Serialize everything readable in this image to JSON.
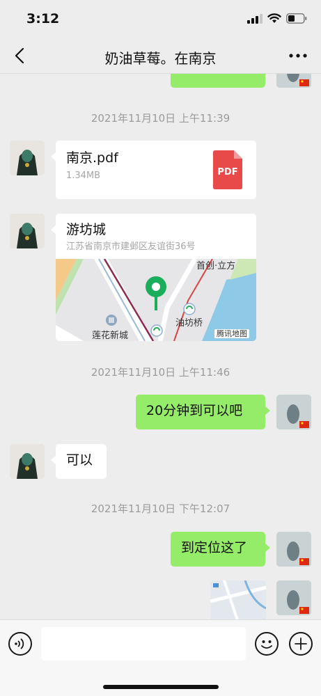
{
  "status_bar": {
    "time": "3:12"
  },
  "nav": {
    "title": "奶油草莓。在南京"
  },
  "messages": {
    "timestamp_1": "2021年11月10日 上午11:39",
    "file": {
      "name": "南京.pdf",
      "size": "1.34MB",
      "icon_label": "PDF"
    },
    "location": {
      "title": "游坊城",
      "address": "江苏省南京市建邺区友谊街36号",
      "map_labels": [
        "首创·立方",
        "油坊桥",
        "莲花新城",
        "腾讯地图"
      ]
    },
    "timestamp_2": "2021年11月10日 上午11:46",
    "outgoing_1": "20分钟到可以吧",
    "incoming_1": "可以",
    "timestamp_3": "2021年11月10日 下午12:07",
    "outgoing_2": "到定位这了"
  },
  "input": {
    "placeholder": ""
  },
  "icons": [
    "back-icon",
    "more-icon",
    "voice-icon",
    "emoji-icon",
    "plus-icon",
    "signal-icon",
    "wifi-icon",
    "battery-icon",
    "pdf-icon",
    "map-pin-icon",
    "flag-icon"
  ],
  "colors": {
    "background": "#ededed",
    "outgoing_bubble": "#95ec69",
    "incoming_bubble": "#ffffff",
    "pdf_red": "#e84a4a",
    "pin_green": "#1aad5b",
    "flag_red": "#de2910"
  }
}
